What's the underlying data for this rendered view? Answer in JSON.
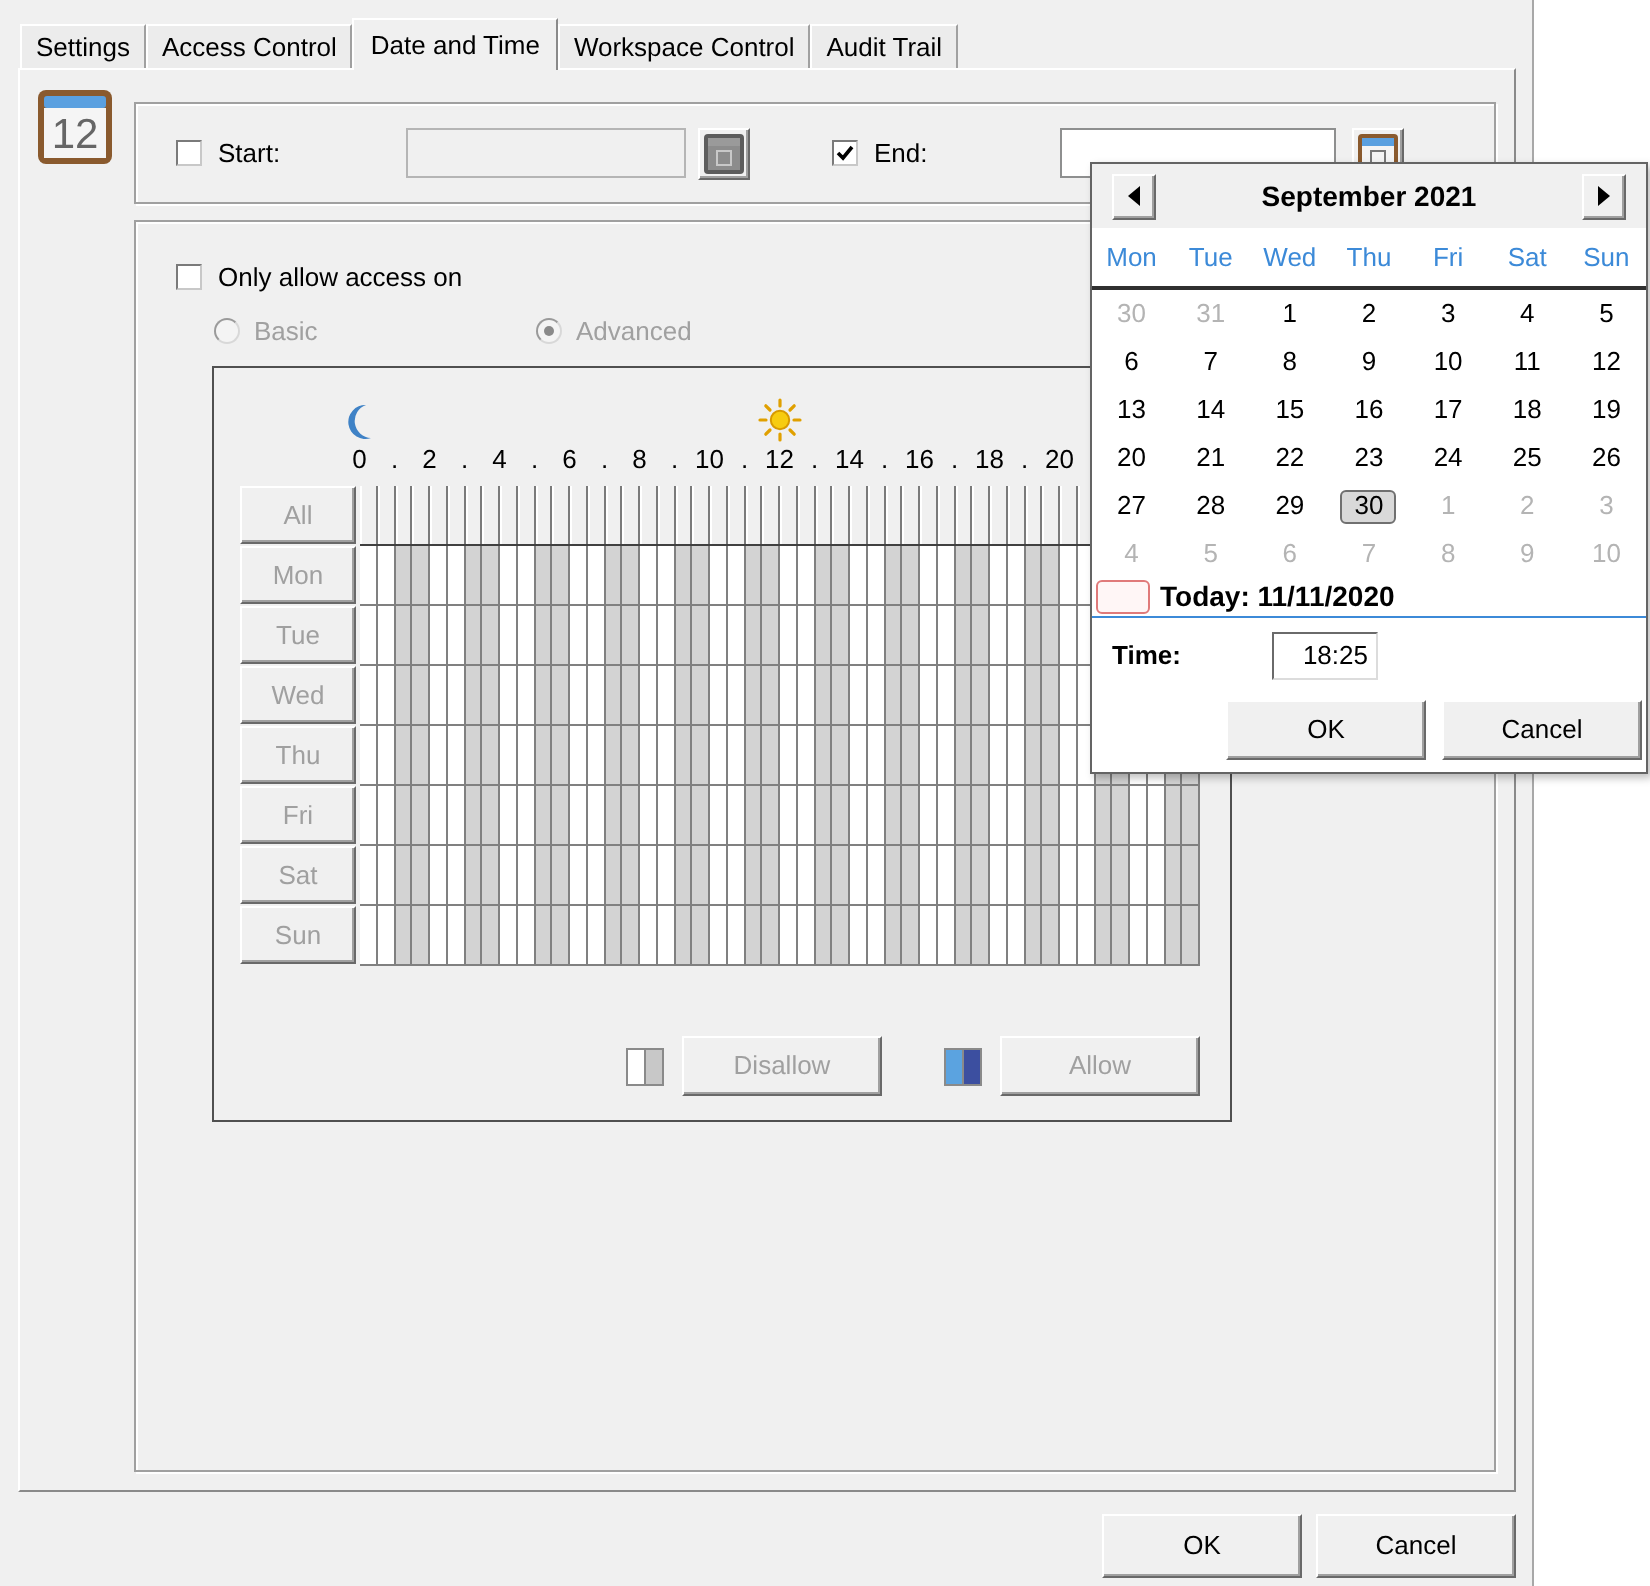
{
  "tabs": [
    {
      "label": "Settings",
      "selected": false
    },
    {
      "label": "Access Control",
      "selected": false
    },
    {
      "label": "Date and Time",
      "selected": true
    },
    {
      "label": "Workspace Control",
      "selected": false
    },
    {
      "label": "Audit Trail",
      "selected": false
    }
  ],
  "header_icon": {
    "date": "12"
  },
  "period": {
    "start": {
      "label": "Start:",
      "checked": false
    },
    "end": {
      "label": "End:",
      "checked": true
    }
  },
  "access": {
    "label": "Only allow access on",
    "checked": false,
    "modes": [
      {
        "label": "Basic",
        "selected": false
      },
      {
        "label": "Advanced",
        "selected": true
      }
    ],
    "hours": [
      "0",
      ".",
      "2",
      ".",
      "4",
      ".",
      "6",
      ".",
      "8",
      ".",
      "10",
      ".",
      "12",
      ".",
      "14",
      ".",
      "16",
      ".",
      "18",
      ".",
      "20"
    ],
    "all_label": "All",
    "days": [
      {
        "label": "Mon",
        "allowed": [
          false,
          false,
          false,
          false,
          false,
          false,
          false,
          false,
          false,
          false,
          false,
          false,
          false,
          false,
          false,
          false,
          false,
          false,
          false,
          false,
          false,
          false,
          false,
          false,
          false,
          false,
          false,
          false,
          false,
          false,
          false,
          false,
          false,
          false,
          false,
          false,
          false,
          false,
          false,
          false,
          false,
          false
        ]
      },
      {
        "label": "Tue",
        "allowed": [
          false,
          false,
          false,
          false,
          false,
          false,
          false,
          false,
          false,
          false,
          false,
          false,
          false,
          false,
          false,
          false,
          false,
          false,
          false,
          false,
          false,
          false,
          false,
          false,
          false,
          false,
          false,
          false,
          false,
          false,
          false,
          false,
          false,
          false,
          false,
          false,
          false,
          false,
          false,
          false,
          false,
          false
        ]
      },
      {
        "label": "Wed",
        "allowed": [
          false,
          false,
          false,
          false,
          false,
          false,
          false,
          false,
          false,
          false,
          false,
          false,
          false,
          false,
          false,
          false,
          false,
          false,
          false,
          false,
          false,
          false,
          false,
          false,
          false,
          false,
          false,
          false,
          false,
          false,
          false,
          false,
          false,
          false,
          false,
          false,
          false,
          false,
          false,
          false,
          false,
          false
        ]
      },
      {
        "label": "Thu",
        "allowed": [
          false,
          false,
          false,
          false,
          false,
          false,
          false,
          false,
          false,
          false,
          false,
          false,
          false,
          false,
          false,
          false,
          false,
          false,
          false,
          false,
          false,
          false,
          false,
          false,
          false,
          false,
          false,
          false,
          false,
          false,
          false,
          false,
          false,
          false,
          false,
          false,
          false,
          false,
          false,
          false,
          false,
          false,
          false,
          false,
          false,
          false,
          false,
          false
        ]
      },
      {
        "label": "Fri",
        "allowed": [
          false,
          false,
          false,
          false,
          false,
          false,
          false,
          false,
          false,
          false,
          false,
          false,
          false,
          false,
          false,
          false,
          false,
          false,
          false,
          false,
          false,
          false,
          false,
          false,
          false,
          false,
          false,
          false,
          false,
          false,
          false,
          false,
          false,
          false,
          false,
          false,
          false,
          false,
          false,
          false,
          false,
          false,
          false,
          false,
          false,
          false,
          false,
          false
        ]
      },
      {
        "label": "Sat",
        "allowed": [
          false,
          false,
          false,
          false,
          false,
          false,
          false,
          false,
          false,
          false,
          false,
          false,
          false,
          false,
          false,
          false,
          false,
          false,
          false,
          false,
          false,
          false,
          false,
          false,
          false,
          false,
          false,
          false,
          false,
          false,
          false,
          false,
          false,
          false,
          false,
          false,
          false,
          false,
          false,
          false,
          false,
          false,
          false,
          false,
          false,
          false,
          false,
          false
        ]
      },
      {
        "label": "Sun",
        "allowed": [
          false,
          false,
          false,
          false,
          false,
          false,
          false,
          false,
          false,
          false,
          false,
          false,
          false,
          false,
          false,
          false,
          false,
          false,
          false,
          false,
          false,
          false,
          false,
          false,
          false,
          false,
          false,
          false,
          false,
          false,
          false,
          false,
          false,
          false,
          false,
          false,
          false,
          false,
          false,
          false,
          false,
          false,
          false,
          false,
          false,
          false,
          false,
          false
        ]
      }
    ],
    "legend": [
      {
        "kind": "disallow",
        "label": "Disallow"
      },
      {
        "kind": "allow",
        "label": "Allow"
      }
    ]
  },
  "calendar": {
    "month": "September 2021",
    "weekdays": [
      "Mon",
      "Tue",
      "Wed",
      "Thu",
      "Fri",
      "Sat",
      "Sun"
    ],
    "weeks": [
      [
        {
          "day": "30",
          "in_month": false,
          "selected": false
        },
        {
          "day": "31",
          "in_month": false,
          "selected": false
        },
        {
          "day": "1",
          "in_month": true,
          "selected": false
        },
        {
          "day": "2",
          "in_month": true,
          "selected": false
        },
        {
          "day": "3",
          "in_month": true,
          "selected": false
        },
        {
          "day": "4",
          "in_month": true,
          "selected": false
        },
        {
          "day": "5",
          "in_month": true,
          "selected": false
        }
      ],
      [
        {
          "day": "6",
          "in_month": true,
          "selected": false
        },
        {
          "day": "7",
          "in_month": true,
          "selected": false
        },
        {
          "day": "8",
          "in_month": true,
          "selected": false
        },
        {
          "day": "9",
          "in_month": true,
          "selected": false
        },
        {
          "day": "10",
          "in_month": true,
          "selected": false
        },
        {
          "day": "11",
          "in_month": true,
          "selected": false
        },
        {
          "day": "12",
          "in_month": true,
          "selected": false
        }
      ],
      [
        {
          "day": "13",
          "in_month": true,
          "selected": false
        },
        {
          "day": "14",
          "in_month": true,
          "selected": false
        },
        {
          "day": "15",
          "in_month": true,
          "selected": false
        },
        {
          "day": "16",
          "in_month": true,
          "selected": false
        },
        {
          "day": "17",
          "in_month": true,
          "selected": false
        },
        {
          "day": "18",
          "in_month": true,
          "selected": false
        },
        {
          "day": "19",
          "in_month": true,
          "selected": false
        }
      ],
      [
        {
          "day": "20",
          "in_month": true,
          "selected": false
        },
        {
          "day": "21",
          "in_month": true,
          "selected": false
        },
        {
          "day": "22",
          "in_month": true,
          "selected": false
        },
        {
          "day": "23",
          "in_month": true,
          "selected": false
        },
        {
          "day": "24",
          "in_month": true,
          "selected": false
        },
        {
          "day": "25",
          "in_month": true,
          "selected": false
        },
        {
          "day": "26",
          "in_month": true,
          "selected": false
        }
      ],
      [
        {
          "day": "27",
          "in_month": true,
          "selected": false
        },
        {
          "day": "28",
          "in_month": true,
          "selected": false
        },
        {
          "day": "29",
          "in_month": true,
          "selected": false
        },
        {
          "day": "30",
          "in_month": true,
          "selected": true
        },
        {
          "day": "1",
          "in_month": false,
          "selected": false
        },
        {
          "day": "2",
          "in_month": false,
          "selected": false
        },
        {
          "day": "3",
          "in_month": false,
          "selected": false
        }
      ],
      [
        {
          "day": "4",
          "in_month": false,
          "selected": false
        },
        {
          "day": "5",
          "in_month": false,
          "selected": false
        },
        {
          "day": "6",
          "in_month": false,
          "selected": false
        },
        {
          "day": "7",
          "in_month": false,
          "selected": false
        },
        {
          "day": "8",
          "in_month": false,
          "selected": false
        },
        {
          "day": "9",
          "in_month": false,
          "selected": false
        },
        {
          "day": "10",
          "in_month": false,
          "selected": false
        }
      ]
    ],
    "today": "Today: 11/11/2020",
    "time_label": "Time:",
    "time": "18:25",
    "buttons": [
      "OK",
      "Cancel"
    ]
  },
  "buttons": [
    "OK",
    "Cancel"
  ]
}
